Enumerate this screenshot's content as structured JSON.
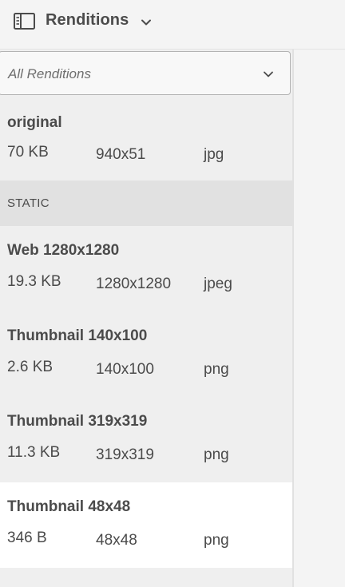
{
  "header": {
    "title": "Renditions"
  },
  "filter": {
    "selected": "All Renditions"
  },
  "original": {
    "name": "original",
    "size": "70 KB",
    "dimensions": "940x51",
    "format": "jpg"
  },
  "section": {
    "label": "STATIC"
  },
  "renditions": [
    {
      "name": "Web 1280x1280",
      "size": "19.3 KB",
      "dimensions": "1280x1280",
      "format": "jpeg"
    },
    {
      "name": "Thumbnail 140x100",
      "size": "2.6 KB",
      "dimensions": "140x100",
      "format": "png"
    },
    {
      "name": "Thumbnail 319x319",
      "size": "11.3 KB",
      "dimensions": "319x319",
      "format": "png"
    },
    {
      "name": "Thumbnail 48x48",
      "size": "346 B",
      "dimensions": "48x48",
      "format": "png",
      "selected": true
    }
  ],
  "icons": {
    "rail": "rail-toggle-icon",
    "header_chevron": "chevron-down-icon",
    "filter_chevron": "chevron-down-icon"
  },
  "colors": {
    "background": "#f4f4f4",
    "panel": "#efefef",
    "section_header": "#e1e1e1",
    "selected_row": "#ffffff",
    "text": "#4b4b4b"
  }
}
